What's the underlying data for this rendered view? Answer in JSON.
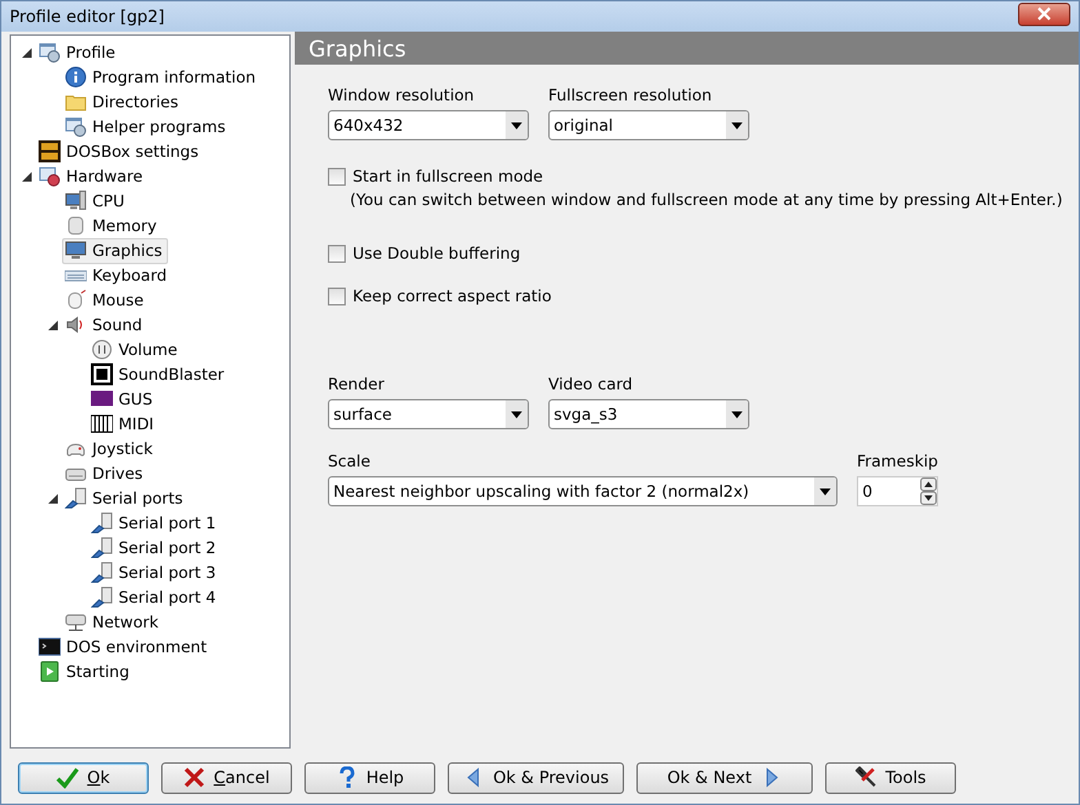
{
  "window": {
    "title": "Profile editor [gp2]"
  },
  "tree": [
    {
      "label": "Profile",
      "kind": "profile",
      "expanded": true,
      "selected": false,
      "children": [
        {
          "label": "Program information",
          "kind": "info",
          "selected": false
        },
        {
          "label": "Directories",
          "kind": "folder",
          "selected": false
        },
        {
          "label": "Helper programs",
          "kind": "profile",
          "selected": false
        }
      ]
    },
    {
      "label": "DOSBox settings",
      "kind": "dosbox",
      "selected": false
    },
    {
      "label": "Hardware",
      "kind": "hardware",
      "expanded": true,
      "selected": false,
      "children": [
        {
          "label": "CPU",
          "kind": "computer",
          "selected": false
        },
        {
          "label": "Memory",
          "kind": "memory",
          "selected": false
        },
        {
          "label": "Graphics",
          "kind": "monitor",
          "selected": true
        },
        {
          "label": "Keyboard",
          "kind": "keyboard",
          "selected": false
        },
        {
          "label": "Mouse",
          "kind": "mouse",
          "selected": false
        },
        {
          "label": "Sound",
          "kind": "speaker",
          "expanded": true,
          "selected": false,
          "children": [
            {
              "label": "Volume",
              "kind": "volume",
              "selected": false
            },
            {
              "label": "SoundBlaster",
              "kind": "card",
              "selected": false
            },
            {
              "label": "GUS",
              "kind": "gus",
              "selected": false
            },
            {
              "label": "MIDI",
              "kind": "midi",
              "selected": false
            }
          ]
        },
        {
          "label": "Joystick",
          "kind": "gamepad",
          "selected": false
        },
        {
          "label": "Drives",
          "kind": "drive",
          "selected": false
        },
        {
          "label": "Serial ports",
          "kind": "plug",
          "expanded": true,
          "selected": false,
          "children": [
            {
              "label": "Serial port 1",
              "kind": "plug",
              "selected": false
            },
            {
              "label": "Serial port 2",
              "kind": "plug",
              "selected": false
            },
            {
              "label": "Serial port 3",
              "kind": "plug",
              "selected": false
            },
            {
              "label": "Serial port 4",
              "kind": "plug",
              "selected": false
            }
          ]
        },
        {
          "label": "Network",
          "kind": "network",
          "selected": false
        }
      ]
    },
    {
      "label": "DOS environment",
      "kind": "terminal",
      "selected": false
    },
    {
      "label": "Starting",
      "kind": "play",
      "selected": false
    }
  ],
  "page": {
    "title": "Graphics"
  },
  "window_resolution": {
    "label": "Window resolution",
    "value": "640x432"
  },
  "fullscreen_resolution": {
    "label": "Fullscreen resolution",
    "value": "original"
  },
  "start_fullscreen": {
    "label": "Start in fullscreen mode",
    "checked": false,
    "hint": "(You can switch between window and fullscreen mode at any time by pressing Alt+Enter.)"
  },
  "double_buffering": {
    "label": "Use Double buffering",
    "checked": false
  },
  "aspect_ratio": {
    "label": "Keep correct aspect ratio",
    "checked": false
  },
  "render": {
    "label": "Render",
    "value": "surface"
  },
  "video_card": {
    "label": "Video card",
    "value": "svga_s3"
  },
  "scale": {
    "label": "Scale",
    "value": "Nearest neighbor upscaling with factor 2 (normal2x)"
  },
  "frameskip": {
    "label": "Frameskip",
    "value": "0"
  },
  "buttons": [
    {
      "label": "Ok",
      "kind": "ok",
      "default": true,
      "underline_first": true
    },
    {
      "label": "Cancel",
      "kind": "cancel",
      "default": false,
      "underline_first": true
    },
    {
      "label": "Help",
      "kind": "help",
      "default": false,
      "underline_first": false
    },
    {
      "label": "Ok & Previous",
      "kind": "previous",
      "default": false,
      "underline_first": false
    },
    {
      "label": "Ok & Next",
      "kind": "next",
      "default": false,
      "underline_first": false
    },
    {
      "label": "Tools",
      "kind": "tools",
      "default": false,
      "underline_first": false
    }
  ]
}
